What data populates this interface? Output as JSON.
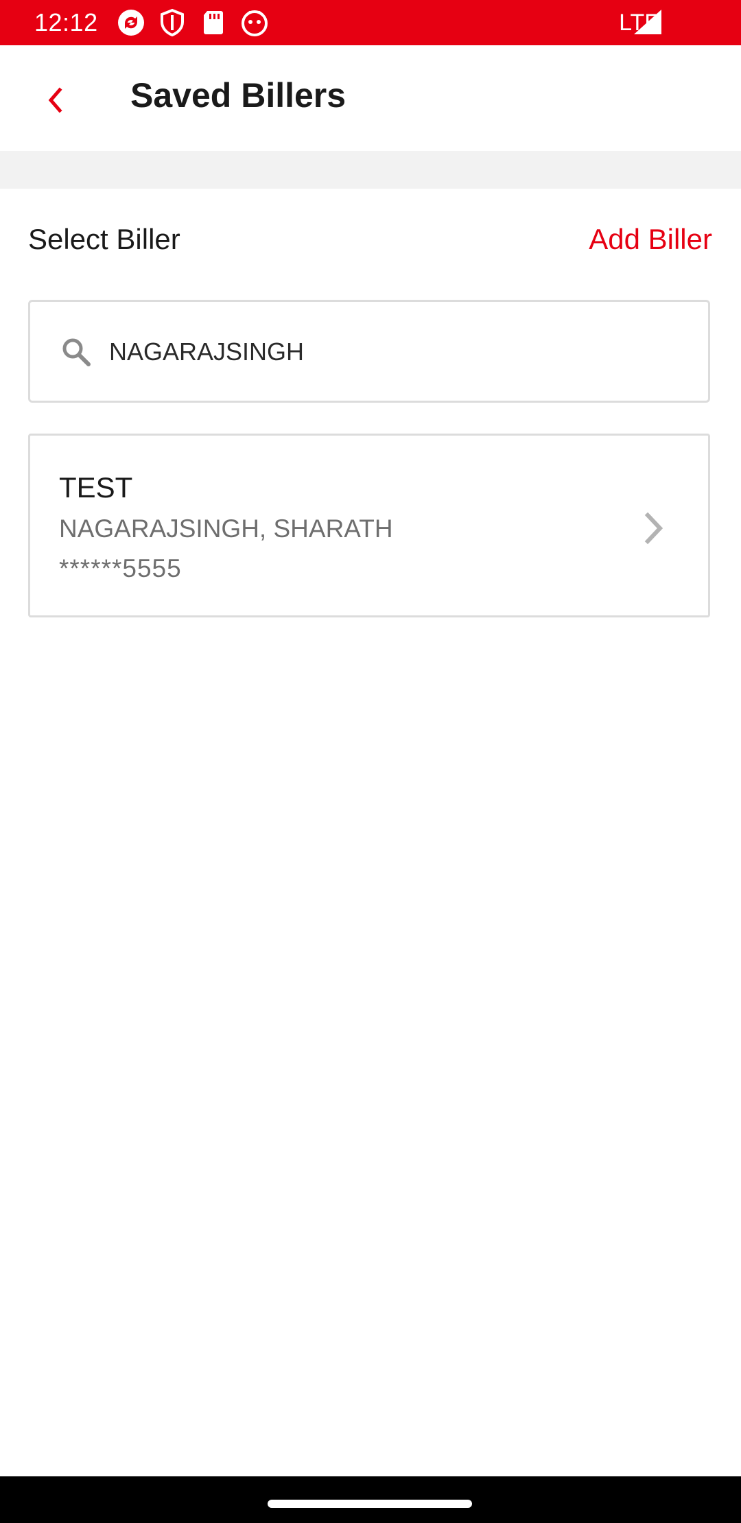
{
  "status_bar": {
    "time": "12:12",
    "network": "LTE",
    "icons": [
      "sync-icon",
      "shield-icon",
      "sd-card-icon",
      "app-icon",
      "signal-icon"
    ],
    "background": "#e60012"
  },
  "header": {
    "title": "Saved Billers",
    "back_icon": "chevron-left-icon"
  },
  "section": {
    "label": "Select Biller",
    "add_label": "Add Biller"
  },
  "search": {
    "icon": "search-icon",
    "value": "NAGARAJSINGH"
  },
  "billers": [
    {
      "name": "TEST",
      "holder": "NAGARAJSINGH, SHARATH",
      "account": "******5555"
    }
  ],
  "colors": {
    "accent": "#e60012",
    "text_primary": "#1a1a1a",
    "text_secondary": "#6e6e6e",
    "border": "#dcdcdc"
  }
}
